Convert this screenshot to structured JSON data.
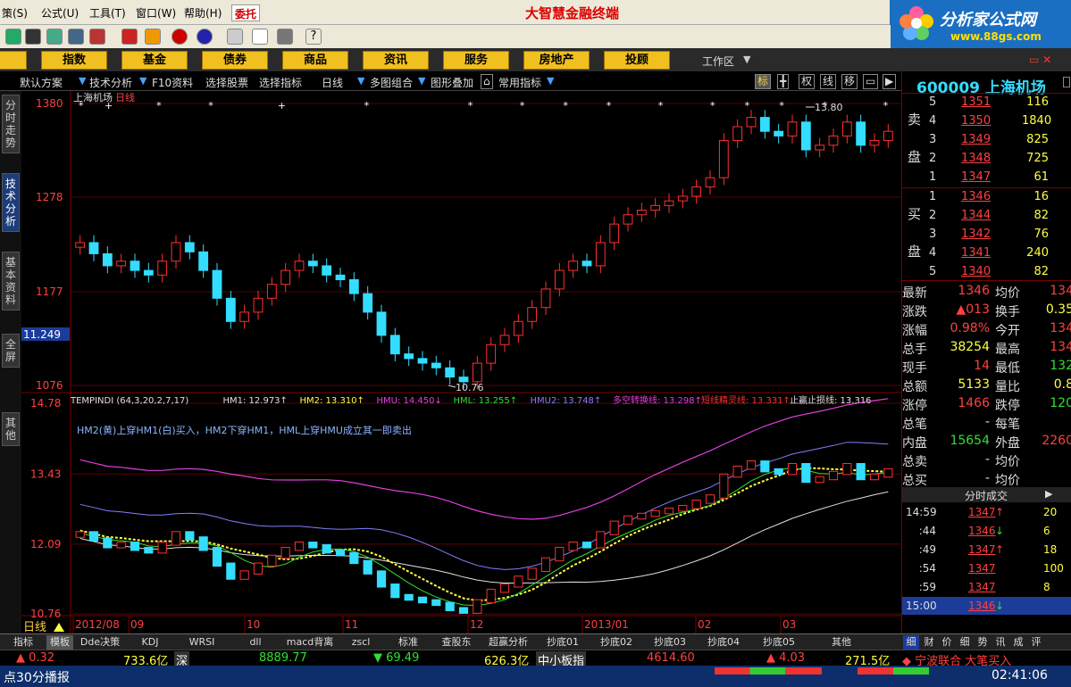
{
  "menu": {
    "items": [
      "策(S)",
      "公式(U)",
      "工具(T)",
      "窗口(W)",
      "帮助(H)"
    ],
    "order_button": "委托",
    "brand": "大智慧金融终端"
  },
  "logo": {
    "text": "分析家公式网",
    "url": "www.88gs.com"
  },
  "categories": [
    "股",
    "指数",
    "基金",
    "债券",
    "商品",
    "资讯",
    "服务",
    "房地产",
    "投顾"
  ],
  "workarea": "工作区",
  "subbar": {
    "items": [
      "默认方案",
      "技术分析",
      "F10资料",
      "选择股票",
      "选择指标",
      "日线",
      "多图组合",
      "图形叠加",
      "常用指标"
    ],
    "tools": [
      "标",
      "权",
      "线",
      "移"
    ]
  },
  "sidetabs": [
    "分时走势",
    "技术分析",
    "基本资料",
    "全屏",
    "其他"
  ],
  "chart": {
    "title": "上海机场",
    "period_tag": "日线",
    "price_axis": [
      "1380",
      "1278",
      "1177",
      "1076"
    ],
    "price_marker": "11.249",
    "high_label": "13.80",
    "low_label": "10.76",
    "indicator_header": [
      {
        "text": "TEMPINDI (64,3,20,2,7,17)",
        "color": "#e0e0e0"
      },
      {
        "text": "HM1: 12.973↑",
        "color": "#e0e0e0"
      },
      {
        "text": "HM2: 13.310↑",
        "color": "#ffff40"
      },
      {
        "text": "HMU: 14.450↓",
        "color": "#e040e0"
      },
      {
        "text": "HML: 13.255↑",
        "color": "#30e030"
      },
      {
        "text": "HMU2: 13.748↑",
        "color": "#8080ff"
      },
      {
        "text": "多空转换线: 13.298↑",
        "color": "#e040e0"
      },
      {
        "text": "短线精灵线: 13.331↑",
        "color": "#ff3030"
      },
      {
        "text": "止赢止损线: 13.316",
        "color": "#e0e0e0"
      }
    ],
    "indicator_note": "HM2(黄)上穿HM1(白)买入，HM2下穿HM1，HML上穿HMU成立其一即卖出",
    "ind_axis": [
      "14.78",
      "13.43",
      "12.09",
      "10.76"
    ],
    "date_labels": [
      "2012/08",
      "09",
      "10",
      "11",
      "12",
      "2013/01",
      "02",
      "03"
    ],
    "footer_label": "日线"
  },
  "chart_data": {
    "type": "candlestick",
    "title": "上海机场",
    "ylabel": "",
    "ylim": [
      10.76,
      13.8
    ],
    "x_labels": [
      "2012/08",
      "09",
      "10",
      "11",
      "12",
      "2013/01",
      "02",
      "03"
    ],
    "close": [
      12.3,
      12.18,
      12.05,
      12.1,
      12.0,
      11.95,
      12.1,
      12.3,
      12.2,
      12.0,
      11.7,
      11.45,
      11.55,
      11.7,
      11.85,
      12.0,
      12.1,
      12.05,
      11.95,
      11.9,
      11.75,
      11.55,
      11.3,
      11.1,
      11.05,
      11.0,
      10.95,
      10.85,
      10.8,
      11.0,
      11.2,
      11.3,
      11.45,
      11.6,
      11.8,
      12.0,
      12.1,
      12.05,
      12.3,
      12.5,
      12.6,
      12.65,
      12.7,
      12.75,
      12.8,
      12.9,
      13.0,
      13.4,
      13.55,
      13.65,
      13.5,
      13.45,
      13.6,
      13.3,
      13.35,
      13.45,
      13.6,
      13.35,
      13.4,
      13.5
    ],
    "indicator": {
      "HM1": 12.973,
      "HM2": 13.31,
      "HMU": 14.45,
      "HML": 13.255,
      "HMU2": 13.748,
      "多空转换线": 13.298,
      "短线精灵线": 13.331,
      "止赢止损线": 13.316
    },
    "ind_ylim": [
      10.76,
      14.78
    ]
  },
  "quote": {
    "code": "600009",
    "name": "上海机场",
    "sell_label": [
      "卖",
      "盘"
    ],
    "buy_label": [
      "买",
      "盘"
    ],
    "sell": [
      {
        "lvl": "5",
        "price": "1351",
        "vol": "116"
      },
      {
        "lvl": "4",
        "price": "1350",
        "vol": "1840"
      },
      {
        "lvl": "3",
        "price": "1349",
        "vol": "825"
      },
      {
        "lvl": "2",
        "price": "1348",
        "vol": "725"
      },
      {
        "lvl": "1",
        "price": "1347",
        "vol": "61"
      }
    ],
    "buy": [
      {
        "lvl": "1",
        "price": "1346",
        "vol": "16"
      },
      {
        "lvl": "2",
        "price": "1344",
        "vol": "82"
      },
      {
        "lvl": "3",
        "price": "1342",
        "vol": "76"
      },
      {
        "lvl": "4",
        "price": "1341",
        "vol": "240"
      },
      {
        "lvl": "5",
        "price": "1340",
        "vol": "82"
      }
    ],
    "stats": [
      {
        "l1": "最新",
        "v1": "1346",
        "c1": "#ff4040",
        "l2": "均价",
        "v2": "134",
        "c2": "#ff4040"
      },
      {
        "l1": "涨跌",
        "v1": "▲013",
        "c1": "#ff4040",
        "l2": "换手",
        "v2": "0.35",
        "c2": "#ffff40"
      },
      {
        "l1": "涨幅",
        "v1": "0.98%",
        "c1": "#ff4040",
        "l2": "今开",
        "v2": "134",
        "c2": "#ff4040"
      },
      {
        "l1": "总手",
        "v1": "38254",
        "c1": "#ffff40",
        "l2": "最高",
        "v2": "134",
        "c2": "#ff4040"
      },
      {
        "l1": "现手",
        "v1": "14",
        "c1": "#ff4040",
        "l2": "最低",
        "v2": "132",
        "c2": "#30e030"
      },
      {
        "l1": "总额",
        "v1": "5133",
        "c1": "#ffff40",
        "l2": "量比",
        "v2": "0.8",
        "c2": "#ffff40"
      },
      {
        "l1": "涨停",
        "v1": "1466",
        "c1": "#ff4040",
        "l2": "跌停",
        "v2": "120",
        "c2": "#30e030"
      },
      {
        "l1": "总笔",
        "v1": "-",
        "c1": "#ddd",
        "l2": "每笔",
        "v2": "",
        "c2": "#ddd"
      },
      {
        "l1": "内盘",
        "v1": "15654",
        "c1": "#30e030",
        "l2": "外盘",
        "v2": "2260",
        "c2": "#ff4040"
      },
      {
        "l1": "总卖",
        "v1": "-",
        "c1": "#ddd",
        "l2": "均价",
        "v2": "",
        "c2": "#ddd"
      },
      {
        "l1": "总买",
        "v1": "-",
        "c1": "#ddd",
        "l2": "均价",
        "v2": "",
        "c2": "#ddd"
      }
    ],
    "trades_title": "分时成交",
    "trades": [
      {
        "t": "14:59",
        "p": "1347",
        "a": "↑",
        "v": "20",
        "pc": "#ff4040",
        "ac": "#ff4040"
      },
      {
        "t": ":44",
        "p": "1346",
        "a": "↓",
        "v": "6",
        "pc": "#ff4040",
        "ac": "#30e030"
      },
      {
        "t": ":49",
        "p": "1347",
        "a": "↑",
        "v": "18",
        "pc": "#ff4040",
        "ac": "#ff4040"
      },
      {
        "t": ":54",
        "p": "1347",
        "a": "",
        "v": "100",
        "pc": "#ff4040",
        "ac": "#ff4040"
      },
      {
        "t": ":59",
        "p": "1347",
        "a": "",
        "v": "8",
        "pc": "#ff4040",
        "ac": "#ff4040"
      },
      {
        "t": "15:00",
        "p": "1346",
        "a": "↓",
        "v": "",
        "pc": "#ff4040",
        "ac": "#30e030"
      }
    ],
    "bottom_tabs": [
      "细",
      "财",
      "价",
      "细",
      "势",
      "讯",
      "成",
      "评"
    ]
  },
  "bottom_tabs": [
    "指标",
    "模板",
    "Dde决策",
    "KDJ",
    "WRSI",
    "dll",
    "macd背离",
    "zscl",
    "标准",
    "查股东",
    "超赢分析",
    "抄底01",
    "抄底02",
    "抄底03",
    "抄底04",
    "抄底05",
    "其他"
  ],
  "status": {
    "s1": "▲ 0.32",
    "s2": "733.6亿",
    "s3": "深",
    "s4": "8889.77",
    "s5": "▼ 69.49",
    "s6": "626.3亿",
    "s7": "中小板指",
    "s8": "4614.60",
    "s9": "▲ 4.03",
    "s10": "271.5亿",
    "s11": "◆ 宁波联合 大笔买入",
    "ticker": "点30分播报",
    "clock": "02:41:06"
  },
  "colors": {
    "up": "#ff3030",
    "down": "#33ddff",
    "bg": "#000000",
    "grid": "#7a0000"
  }
}
